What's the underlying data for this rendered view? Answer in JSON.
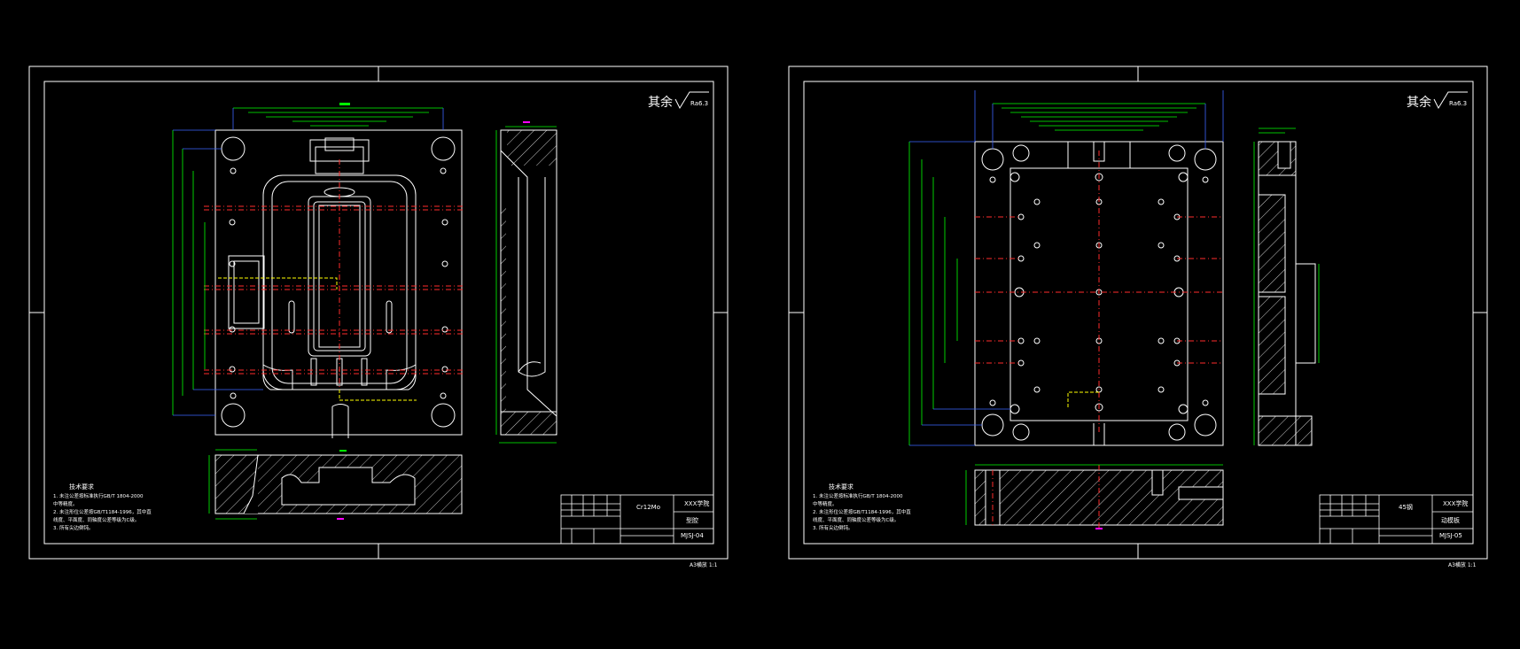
{
  "sheets": [
    {
      "id": "left",
      "roughness_label": "其余",
      "roughness_value": "Ra6.3",
      "notes_title": "技术要求",
      "notes": [
        "1. 未注公差按标准执行GB/T 1804-2000",
        "   中等精度。",
        "2. 未注形位公差按GB/T1184-1996，其中直",
        "   线度、平面度、同轴度公差等级为C级。",
        "3. 所有尖边倒钝。"
      ],
      "title_block": {
        "material": "Cr12Mo",
        "school": "XXX学院",
        "part_name": "型腔",
        "drawing_no": "MJSJ-04"
      },
      "scale_note": "A3横放 1:1"
    },
    {
      "id": "right",
      "roughness_label": "其余",
      "roughness_value": "Ra6.3",
      "notes_title": "技术要求",
      "notes": [
        "1. 未注公差按标准执行GB/T 1804-2000",
        "   中等精度。",
        "2. 未注形位公差按GB/T1184-1996，其中直",
        "   线度、平面度、同轴度公差等级为C级。",
        "3. 所有尖边倒钝。"
      ],
      "title_block": {
        "material": "45钢",
        "school": "XXX学院",
        "part_name": "动模板",
        "drawing_no": "MJSJ-05"
      },
      "scale_note": "A3横放 1:1"
    }
  ],
  "colors": {
    "background": "#000000",
    "outline": "#ffffff",
    "dimension": "#00ff00",
    "dimension_blue": "#3c64ff",
    "center_line": "#ff2b2b",
    "hidden_line": "#ffff00",
    "magenta": "#ff00ff"
  }
}
